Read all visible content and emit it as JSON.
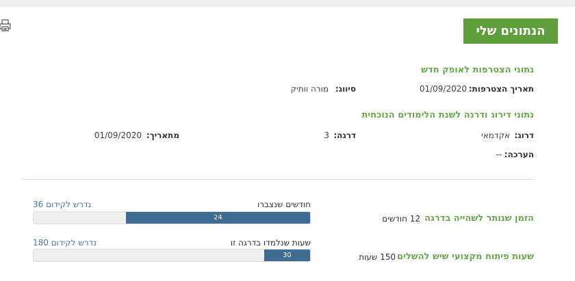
{
  "header": {
    "title": "הנתונים שלי",
    "print_icon": "printer-icon"
  },
  "joining": {
    "section_title": "נתוני הצטרפות לאופק חדש",
    "date_label": "תאריך הצטרפות:",
    "date_value": "01/09/2020",
    "classification_label": "סיווג:",
    "classification_value": "מורה וותיק"
  },
  "ranking": {
    "section_title": "נתוני דירוג ודרגה לשנת הלימודים הנוכחית",
    "rank_label": "דרוג:",
    "rank_value": "אקדמאי",
    "grade_label": "דרגה:",
    "grade_value": "3",
    "from_date_label": "מתאריך:",
    "from_date_value": "01/09/2020",
    "note_label": "הערכה:",
    "note_value": "--"
  },
  "progress": {
    "time_in_grade": {
      "title": "הזמן שנותר לשהייה בדרגה",
      "total_text": "12 חודשים",
      "caption": "חודשים שנצברו",
      "required_text": "נדרש לקידום 36",
      "current_value": "24",
      "current": 24,
      "required": 36
    },
    "training_hours": {
      "title": "שעות פיתוח מקצועי שיש להשלים",
      "total_text": "150 שעות",
      "caption": "שעות שנלמדו בדרגה זו",
      "required_text": "נדרש לקידום 180",
      "current_value": "30",
      "current": 30,
      "required": 180
    }
  },
  "colors": {
    "accent_green": "#5e9f3b",
    "section_green": "#6aa84f",
    "bar_blue": "#3e6b92",
    "link_blue": "#4a79a6"
  }
}
